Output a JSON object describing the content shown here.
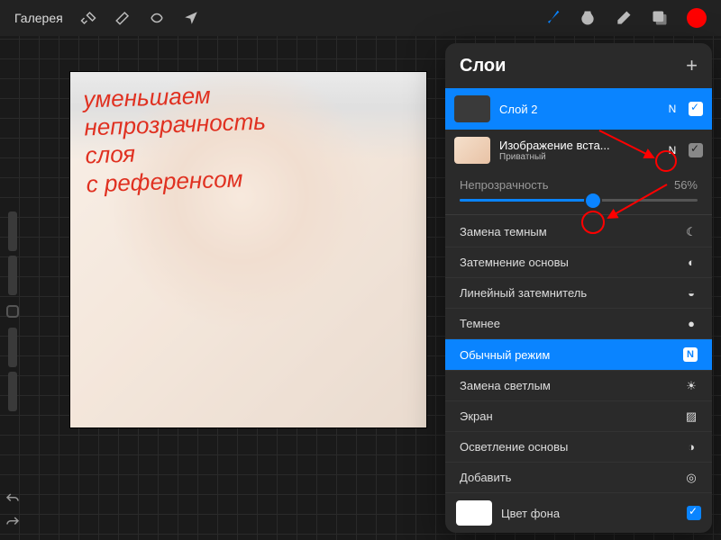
{
  "topbar": {
    "gallery": "Галерея"
  },
  "panel": {
    "title": "Слои"
  },
  "layers": [
    {
      "name": "Слой 2",
      "mode": "N"
    },
    {
      "name": "Изображение вста...",
      "sub": "Приватный",
      "mode": "N"
    }
  ],
  "opacity": {
    "label": "Непрозрачность",
    "value": "56%"
  },
  "blend_modes": {
    "darken": "Замена темным",
    "color_burn": "Затемнение основы",
    "linear_burn": "Линейный затемнитель",
    "darker": "Темнее",
    "normal": "Обычный режим",
    "lighten": "Замена светлым",
    "screen": "Экран",
    "color_dodge": "Осветление основы",
    "add": "Добавить"
  },
  "background": {
    "label": "Цвет фона"
  },
  "handwriting": {
    "l1": "уменьшаем",
    "l2": "непрозрачность",
    "l3": "слоя",
    "l4": "с референсом"
  }
}
